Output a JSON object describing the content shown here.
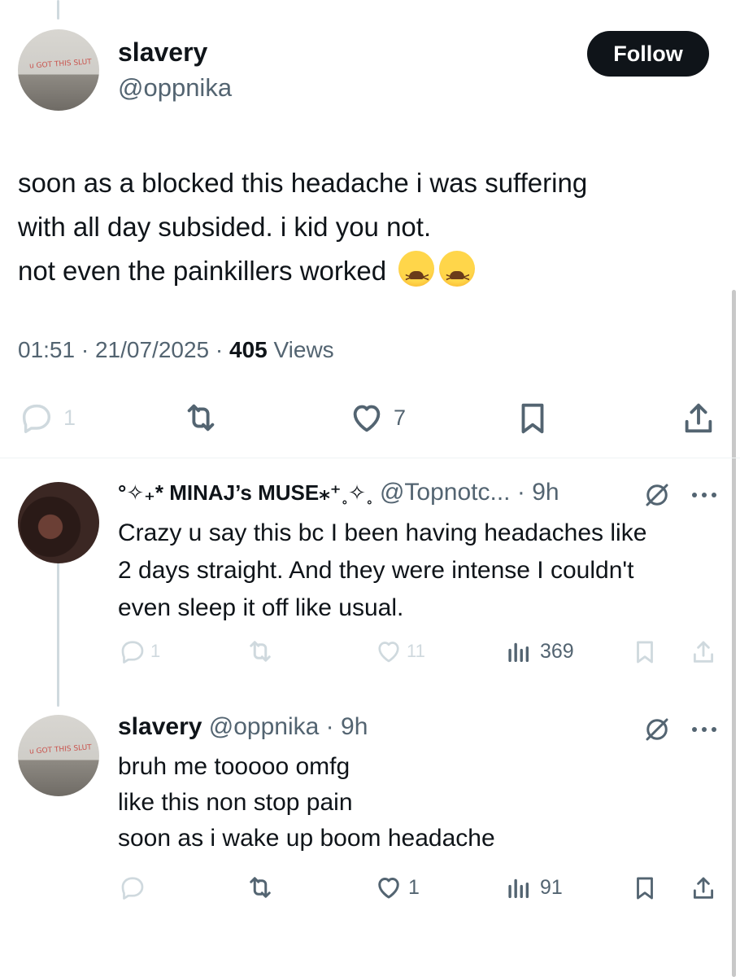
{
  "main_tweet": {
    "display_name": "slavery",
    "handle": "@oppnika",
    "follow_label": "Follow",
    "avatar_scrawl": "u GOT THIS SLUT",
    "text_lines": [
      "soon as a blocked this headache i was suffering",
      "with all day subsided. i kid you not.",
      "not even the painkillers worked"
    ],
    "emoji": [
      "tired-face-emoji",
      "tired-face-emoji"
    ],
    "time": "01:51",
    "date": "21/07/2025",
    "views_count": "405",
    "views_label": "Views",
    "reply_count": "1",
    "like_count": "7"
  },
  "replies": [
    {
      "display_name": "°✧₊* MINAJ’s MUSE⁎⁺˳✧˳",
      "handle": "@Topnotc...",
      "time": "9h",
      "text_lines": [
        "Crazy u say this bc I been having headaches like",
        "2 days straight. And they were intense I couldn't",
        "even sleep it off like usual."
      ],
      "reply_count": "1",
      "like_count": "11",
      "view_count": "369"
    },
    {
      "display_name": "slavery",
      "handle": "@oppnika",
      "time": "9h",
      "text_lines": [
        "bruh me tooooo omfg",
        "like this non stop pain",
        "soon as i wake up boom headache"
      ],
      "like_count": "1",
      "view_count": "91"
    }
  ],
  "colors": {
    "text": "#0f1419",
    "secondary": "#536471",
    "light_icon": "#cfd9de",
    "button": "#0f1419"
  }
}
